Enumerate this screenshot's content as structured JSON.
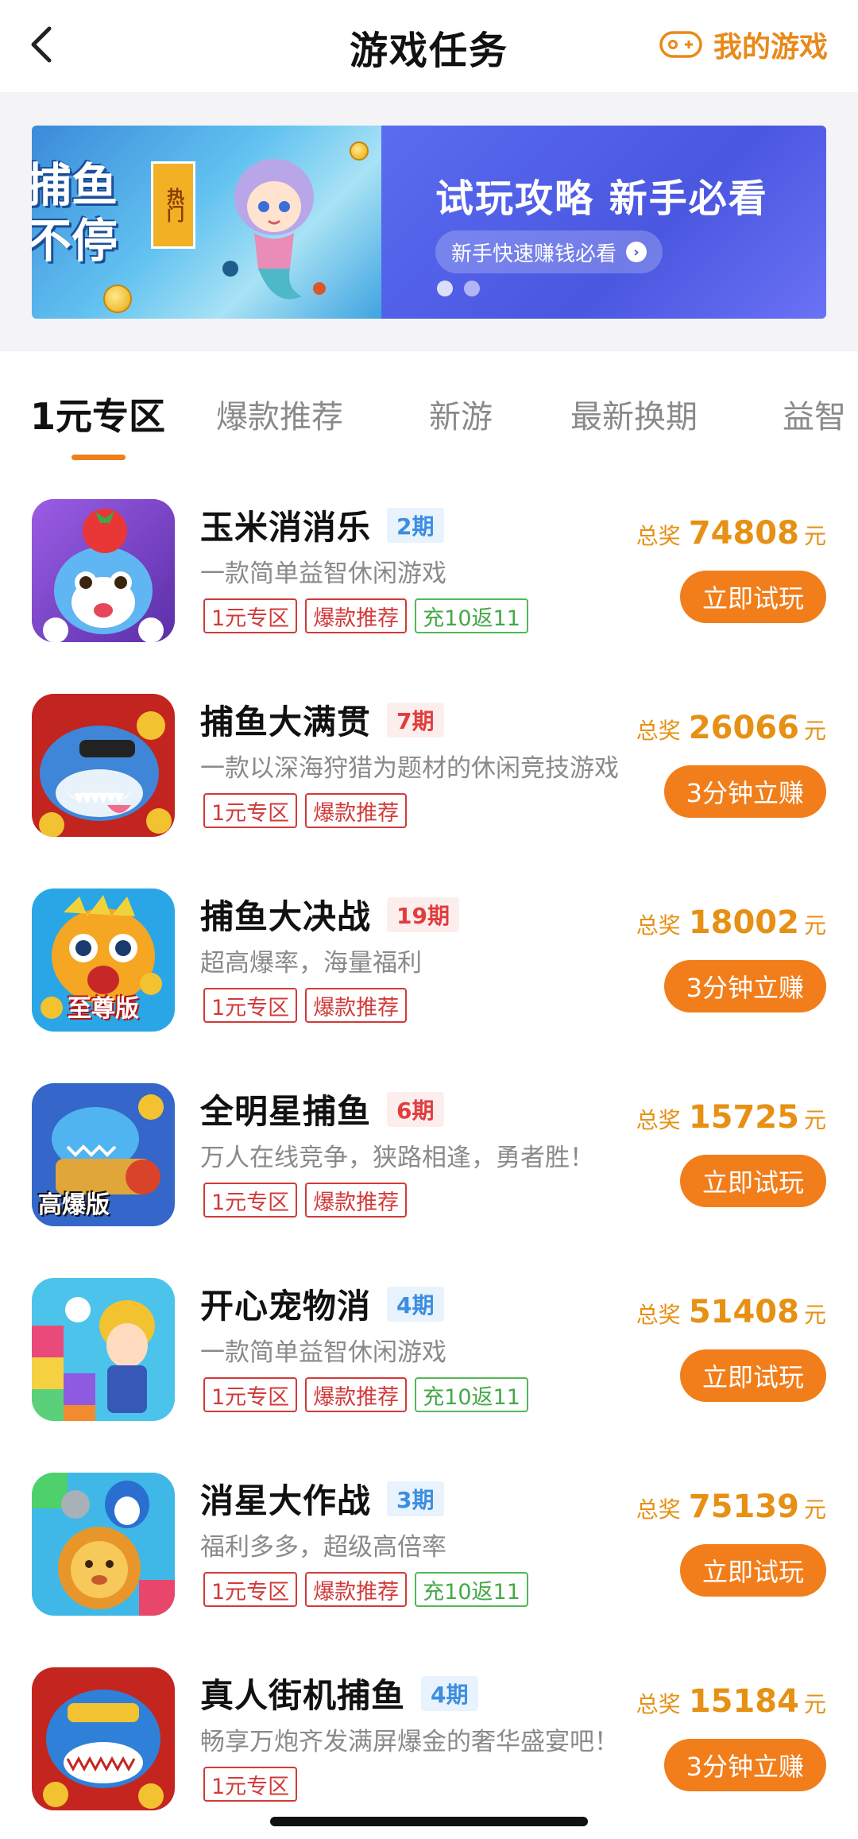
{
  "header": {
    "title": "游戏任务",
    "my_games": "我的游戏"
  },
  "banner": {
    "game_text_line1": "捕鱼",
    "game_text_line2": "不停",
    "hot_tag": "热门",
    "headline": "试玩攻略  新手必看",
    "sub": "新手快速赚钱必看"
  },
  "tabs": [
    {
      "label": "1元专区",
      "active": true
    },
    {
      "label": "爆款推荐"
    },
    {
      "label": "新游"
    },
    {
      "label": "最新换期"
    },
    {
      "label": "益智"
    }
  ],
  "games": [
    {
      "name": "玉米消消乐",
      "period": "2期",
      "period_color": "blue",
      "desc": "一款简单益智休闲游戏",
      "tags": [
        "1元专区",
        "爆款推荐",
        "充10返11"
      ],
      "prize_label": "总奖",
      "prize": "74808",
      "unit": "元",
      "button": "立即试玩"
    },
    {
      "name": "捕鱼大满贯",
      "period": "7期",
      "period_color": "red",
      "desc": "一款以深海狩猎为题材的休闲竞技游戏",
      "tags": [
        "1元专区",
        "爆款推荐"
      ],
      "prize_label": "总奖",
      "prize": "26066",
      "unit": "元",
      "button": "3分钟立赚"
    },
    {
      "name": "捕鱼大决战",
      "period": "19期",
      "period_color": "red",
      "desc": "超高爆率，海量福利",
      "tags": [
        "1元专区",
        "爆款推荐"
      ],
      "prize_label": "总奖",
      "prize": "18002",
      "unit": "元",
      "button": "3分钟立赚"
    },
    {
      "name": "全明星捕鱼",
      "period": "6期",
      "period_color": "red",
      "desc": "万人在线竞争，狭路相逢，勇者胜！",
      "tags": [
        "1元专区",
        "爆款推荐"
      ],
      "prize_label": "总奖",
      "prize": "15725",
      "unit": "元",
      "button": "立即试玩"
    },
    {
      "name": "开心宠物消",
      "period": "4期",
      "period_color": "blue",
      "desc": "一款简单益智休闲游戏",
      "tags": [
        "1元专区",
        "爆款推荐",
        "充10返11"
      ],
      "prize_label": "总奖",
      "prize": "51408",
      "unit": "元",
      "button": "立即试玩"
    },
    {
      "name": "消星大作战",
      "period": "3期",
      "period_color": "blue",
      "desc": "福利多多，超级高倍率",
      "tags": [
        "1元专区",
        "爆款推荐",
        "充10返11"
      ],
      "prize_label": "总奖",
      "prize": "75139",
      "unit": "元",
      "button": "立即试玩"
    },
    {
      "name": "真人街机捕鱼",
      "period": "4期",
      "period_color": "blue",
      "desc": "畅享万炮齐发满屏爆金的奢华盛宴吧！",
      "tags": [
        "1元专区"
      ],
      "prize_label": "总奖",
      "prize": "15184",
      "unit": "元",
      "button": "3分钟立赚"
    }
  ],
  "icon_badges": {
    "game3": "至尊版",
    "game4": "高爆版"
  },
  "colors": {
    "accent": "#f17e1b",
    "prize": "#e69014",
    "tag_red": "#d23a3a",
    "tag_green": "#45a848",
    "period_blue": "#3c8ee0",
    "period_red": "#e03e3e"
  }
}
